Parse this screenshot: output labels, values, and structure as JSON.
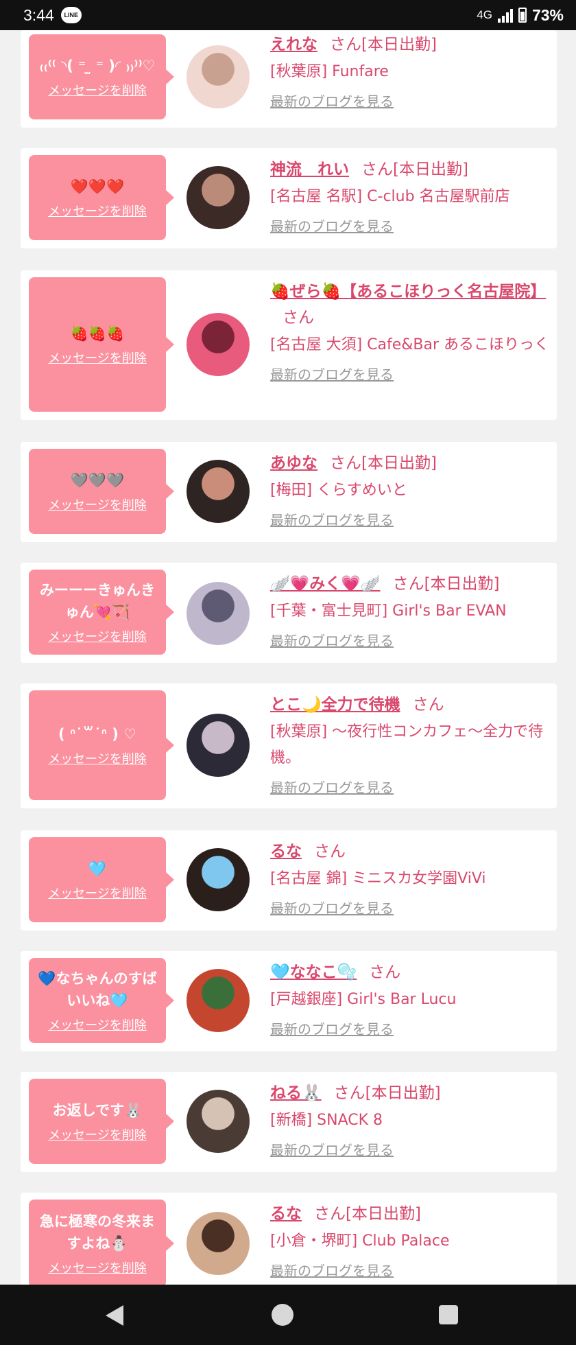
{
  "status_bar": {
    "time": "3:44",
    "app_icon": "LINE",
    "network": "4G",
    "battery": "73%"
  },
  "delete_label": "メッセージを削除",
  "blog_label": "最新のブログを見る",
  "san_label": "さん",
  "entries": [
    {
      "message": "₍₍⁽⁽ ◝( ⁼ ̫ ⁼ )◜ ₎₎⁾⁾♡",
      "name": "えれな",
      "suffix": "[本日出勤]",
      "shop": "[秋葉原] Funfare",
      "avatar_colors": [
        "#f0d7cf",
        "#c9a191"
      ]
    },
    {
      "message": "❤️❤️❤️",
      "name": "神流　れい",
      "suffix": "[本日出勤]",
      "shop": "[名古屋 名駅] C-club 名古屋駅前店",
      "avatar_colors": [
        "#3b2a26",
        "#b98b78"
      ]
    },
    {
      "message": "🍓🍓🍓",
      "name": "🍓ぜら🍓【あるこほりっく名古屋院】",
      "suffix": "",
      "shop": "[名古屋 大須] Cafe&Bar あるこほりっく",
      "avatar_colors": [
        "#e85b7d",
        "#7b2337"
      ]
    },
    {
      "message": "🩶🩶🩶",
      "name": "あゆな",
      "suffix": "[本日出勤]",
      "shop": "[梅田] くらすめいと",
      "avatar_colors": [
        "#2e2522",
        "#c98d7a"
      ]
    },
    {
      "message": "みーーーきゅんきゅん💘🏹",
      "name": "🪽💗みく💗🪽",
      "suffix": "[本日出勤]",
      "shop": "[千葉・富士見町] Girl's Bar EVAN",
      "avatar_colors": [
        "#bfb7cc",
        "#5e5a74"
      ]
    },
    {
      "message": "(  ᐢ˙꒳˙ᐢ ) ♡",
      "name": "とこ🌙全力で待機",
      "suffix": "",
      "shop": "[秋葉原] 〜夜行性コンカフェ〜全力で待機。",
      "avatar_colors": [
        "#2d2a38",
        "#c8b9c9"
      ]
    },
    {
      "message": "🩵",
      "name": "るな",
      "suffix": "",
      "shop": "[名古屋 錦] ミニスカ女学園ViVi",
      "avatar_colors": [
        "#2a1f1b",
        "#7fc7ef"
      ]
    },
    {
      "message": "💙なちゃんのすばいいね🩵",
      "name": "🩵ななこ🫧",
      "suffix": "",
      "shop": "[戸越銀座] Girl's Bar Lucu",
      "avatar_colors": [
        "#c4462f",
        "#3b6f3a"
      ]
    },
    {
      "message": "お返しです🐰",
      "name": "ねる🐰",
      "suffix": "[本日出勤]",
      "shop": "[新橋] SNACK 8",
      "avatar_colors": [
        "#4a3c35",
        "#d6c2b4"
      ]
    },
    {
      "message": "急に極寒の冬来ますよね⛄",
      "name": "るな",
      "suffix": "[本日出勤]",
      "shop": "[小倉・堺町] Club Palace",
      "avatar_colors": [
        "#d1a98c",
        "#4a2f25"
      ]
    }
  ]
}
